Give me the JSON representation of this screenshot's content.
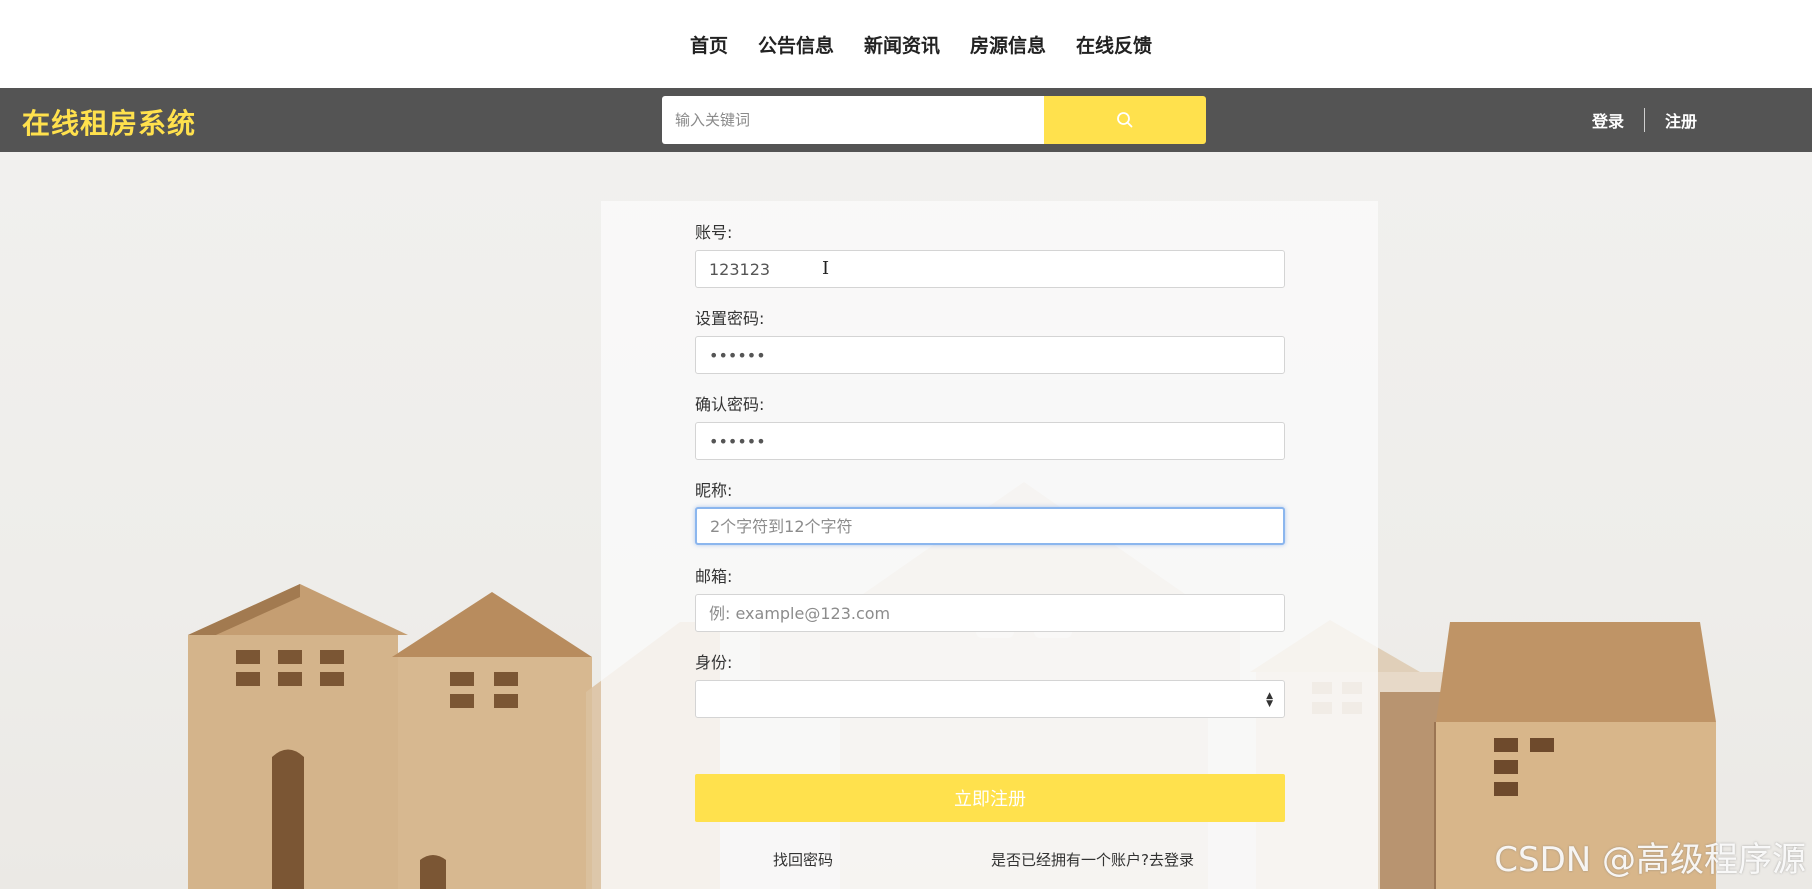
{
  "nav": {
    "items": [
      "首页",
      "公告信息",
      "新闻资讯",
      "房源信息",
      "在线反馈"
    ]
  },
  "header": {
    "brand": "在线租房系统",
    "search_placeholder": "输入关键词",
    "search_icon": "search-icon",
    "login": "登录",
    "register": "注册"
  },
  "form": {
    "account_label": "账号:",
    "account_value": "123123",
    "password_label": "设置密码:",
    "password_value": "123123",
    "confirm_label": "确认密码:",
    "confirm_value": "123123",
    "nickname_label": "昵称:",
    "nickname_placeholder": "2个字符到12个字符",
    "email_label": "邮箱:",
    "email_placeholder": "例: example@123.com",
    "identity_label": "身份:",
    "identity_value": "",
    "submit": "立即注册",
    "forgot": "找回密码",
    "to_login": "是否已经拥有一个账户?去登录"
  },
  "watermark": "CSDN @高级程序源",
  "colors": {
    "accent": "#ffe14d",
    "header_bg": "#545454",
    "focus_border": "#8bb6ee"
  }
}
